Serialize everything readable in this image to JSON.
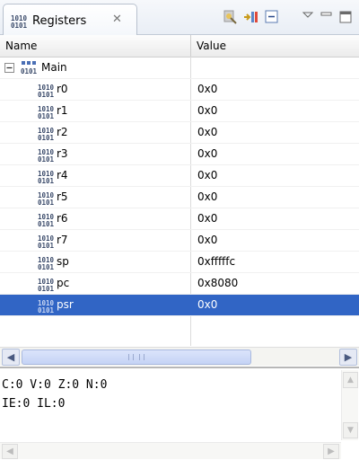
{
  "view": {
    "tab_label": "Registers",
    "toolbar_icons": [
      "debug-tool-icon",
      "columns-icon",
      "collapse-all-icon",
      "view-menu-icon",
      "minimize-icon",
      "maximize-icon"
    ]
  },
  "table": {
    "headers": {
      "name": "Name",
      "value": "Value"
    },
    "group": {
      "label": "Main",
      "expanded": true
    },
    "rows": [
      {
        "name": "r0",
        "value": "0x0"
      },
      {
        "name": "r1",
        "value": "0x0"
      },
      {
        "name": "r2",
        "value": "0x0"
      },
      {
        "name": "r3",
        "value": "0x0"
      },
      {
        "name": "r4",
        "value": "0x0"
      },
      {
        "name": "r5",
        "value": "0x0"
      },
      {
        "name": "r6",
        "value": "0x0"
      },
      {
        "name": "r7",
        "value": "0x0"
      },
      {
        "name": "sp",
        "value": "0xfffffc"
      },
      {
        "name": "pc",
        "value": "0x8080"
      },
      {
        "name": "psr",
        "value": "0x0",
        "selected": true
      }
    ]
  },
  "detail": {
    "lines": [
      "C:0 V:0 Z:0 N:0",
      "IE:0 IL:0"
    ]
  },
  "colors": {
    "selection": "#3165c5",
    "selection_text": "#ffffff"
  }
}
